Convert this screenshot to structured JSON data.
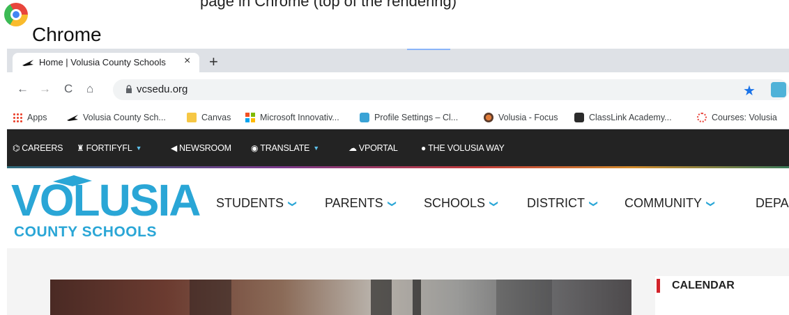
{
  "caption": {
    "fragment": "page in Chrome (top of the rendering)",
    "title": "Chrome"
  },
  "browser": {
    "tab": {
      "title": "Home | Volusia County Schools",
      "close": "×"
    },
    "new_tab": "+",
    "nav": {
      "back": "←",
      "forward": "→",
      "reload": "C",
      "home": "⌂"
    },
    "url": "vcsedu.org",
    "star": "★",
    "bookmarks": [
      {
        "label": "Apps",
        "icon": "apps-grid-icon"
      },
      {
        "label": "Volusia County Sch...",
        "icon": "volusia-favicon"
      },
      {
        "label": "Canvas",
        "icon": "folder-icon"
      },
      {
        "label": "Microsoft Innovativ...",
        "icon": "microsoft-icon"
      },
      {
        "label": "Profile Settings – Cl...",
        "icon": "classlink-icon"
      },
      {
        "label": "Volusia - Focus",
        "icon": "focus-icon"
      },
      {
        "label": "ClassLink Academy...",
        "icon": "classlink-academy-icon"
      },
      {
        "label": "Courses: Volusia",
        "icon": "courses-icon"
      }
    ]
  },
  "site": {
    "topbar": [
      {
        "glyph": "⌬",
        "label": "CAREERS",
        "dropdown": false
      },
      {
        "glyph": "♜",
        "label": "FORTIFYFL",
        "dropdown": true
      },
      {
        "glyph": "◀",
        "label": "NEWSROOM",
        "dropdown": false
      },
      {
        "glyph": "◉",
        "label": "TRANSLATE",
        "dropdown": true
      },
      {
        "glyph": "☁",
        "label": "VPORTAL",
        "dropdown": false
      },
      {
        "glyph": "●",
        "label": "THE VOLUSIA WAY",
        "dropdown": false
      }
    ],
    "logo": {
      "big": "VOLUSIA",
      "small": "COUNTY SCHOOLS"
    },
    "mainnav": [
      "STUDENTS",
      "PARENTS",
      "SCHOOLS",
      "DISTRICT",
      "COMMUNITY",
      "DEPA"
    ],
    "chevron": "❯",
    "sidebar": {
      "label": "CALENDAR"
    }
  },
  "colors": {
    "brand_blue": "#2aa6d6",
    "topbar_bg": "#232323",
    "accent_red": "#d2232a",
    "chrome_blue": "#1a73e8"
  }
}
